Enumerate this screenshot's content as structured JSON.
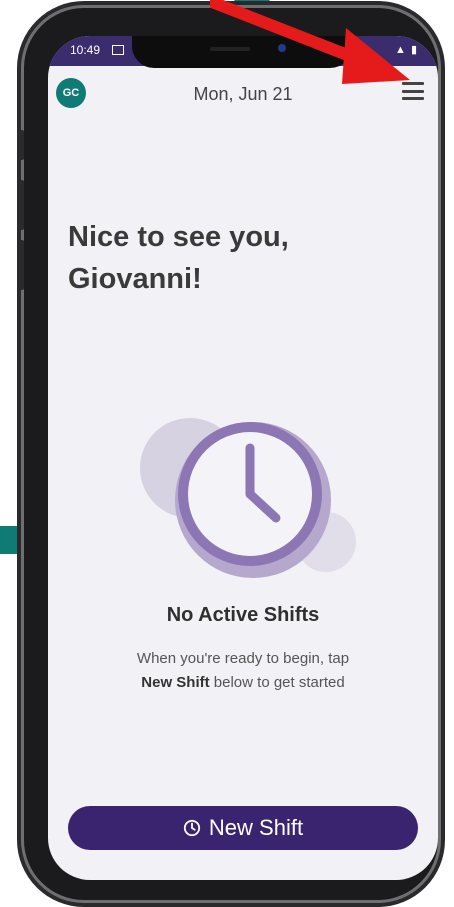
{
  "colors": {
    "accent_teal": "#0f7b74",
    "primary_purple": "#3a2470",
    "status_bar": "#3b2d6d",
    "arrow_red": "#e51b1b"
  },
  "status_bar": {
    "time": "10:49",
    "image_icon": "image-icon",
    "right_icons": ""
  },
  "header": {
    "avatar_initials": "GC",
    "date": "Mon, Jun 21",
    "menu_icon": "hamburger-menu-icon"
  },
  "greeting": {
    "line1": "Nice to see you,",
    "line2": "Giovanni!"
  },
  "empty_state": {
    "illustration_icon": "clock-icon",
    "title": "No Active Shifts",
    "line1": "When you're ready to begin, tap",
    "line2_bold": "New Shift",
    "line2_rest": " below to get started"
  },
  "actions": {
    "new_shift_label": "New Shift",
    "new_shift_icon": "clock-icon"
  }
}
